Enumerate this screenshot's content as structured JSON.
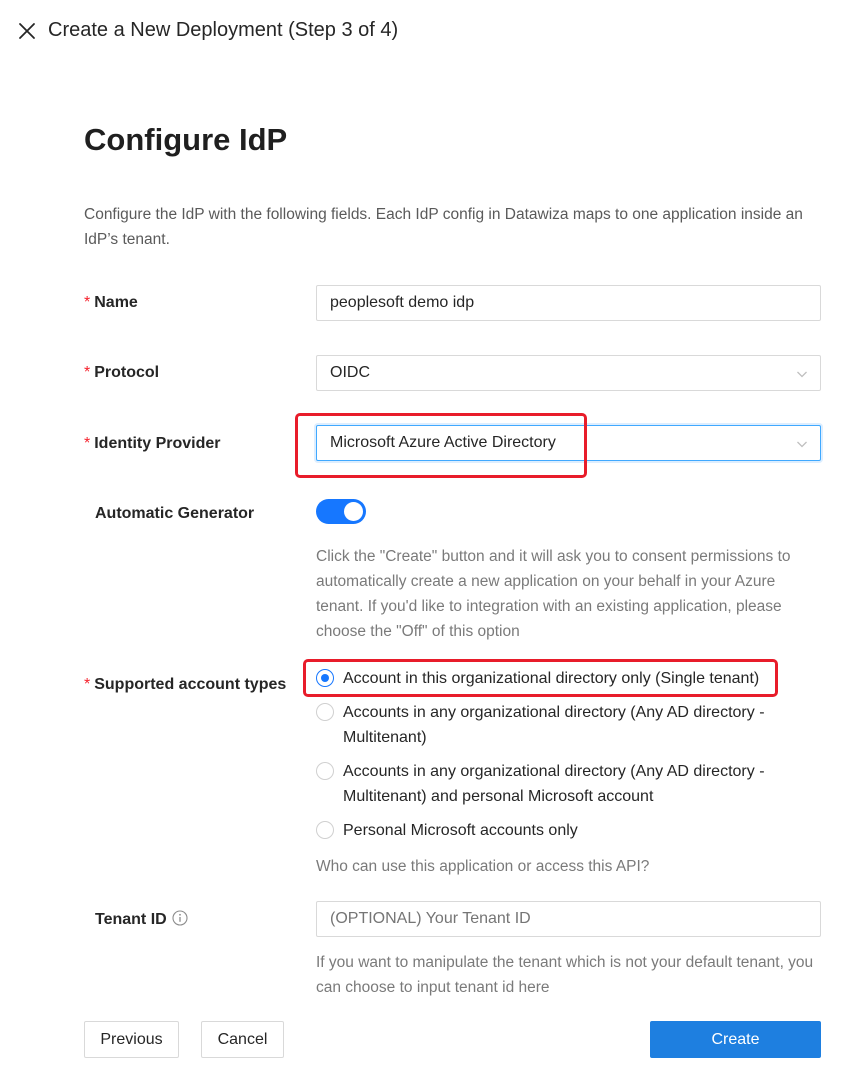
{
  "window": {
    "title": "Create a New Deployment (Step 3 of 4)"
  },
  "page": {
    "title": "Configure IdP",
    "intro": "Configure the IdP with the following fields. Each IdP config in Datawiza maps to one application inside an IdP’s tenant."
  },
  "form": {
    "required_mark": "*",
    "name": {
      "label": "Name",
      "value": "peoplesoft demo idp"
    },
    "protocol": {
      "label": "Protocol",
      "value": "OIDC"
    },
    "identity_provider": {
      "label": "Identity Provider",
      "value": "Microsoft Azure Active Directory"
    },
    "automatic_generator": {
      "label": "Automatic Generator",
      "enabled": true,
      "help": "Click the \"Create\" button and it will ask you to consent permissions to automatically create a new application on your behalf in your Azure tenant. If you'd like to integration with an existing application, please choose the \"Off\" of this option"
    },
    "account_types": {
      "label": "Supported account types",
      "options": [
        {
          "label": "Account in this organizational directory only (Single tenant)",
          "checked": true
        },
        {
          "label": "Accounts in any organizational directory (Any AD directory - Multitenant)",
          "checked": false
        },
        {
          "label": "Accounts in any organizational directory (Any AD directory - Multitenant) and personal Microsoft account",
          "checked": false
        },
        {
          "label": "Personal Microsoft accounts only",
          "checked": false
        }
      ],
      "help": "Who can use this application or access this API?"
    },
    "tenant_id": {
      "label": "Tenant ID",
      "value": "",
      "placeholder": "(OPTIONAL) Your Tenant ID",
      "help": "If you want to manipulate the tenant which is not your default tenant, you can choose to input tenant id here"
    }
  },
  "footer": {
    "previous": "Previous",
    "cancel": "Cancel",
    "create": "Create"
  },
  "colors": {
    "primary": "#1e7fe0",
    "toggle_on": "#1677ff",
    "required": "#f5222d",
    "highlight": "#e81c2a"
  },
  "icons": {
    "close": "close-icon",
    "caret": "chevron-down-icon",
    "info": "info-icon"
  }
}
